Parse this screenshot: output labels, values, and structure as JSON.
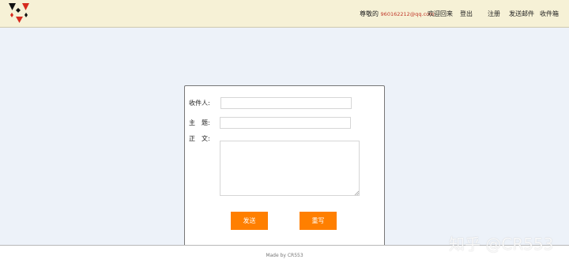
{
  "header": {
    "greeting_prefix": "尊敬的",
    "user_email": "960162212@qq.com",
    "welcome": "欢迎回来",
    "nav": {
      "logout": "登出",
      "register": "注册",
      "send_mail": "发送邮件",
      "inbox": "收件箱"
    }
  },
  "form": {
    "recipient_label": "收件人:",
    "recipient_value": "",
    "subject_label": "主　题:",
    "subject_value": "",
    "body_label": "正　文:",
    "body_value": "",
    "send_button": "发送",
    "rewrite_button": "重写"
  },
  "footer": {
    "text": "Made by CR553"
  },
  "watermark": "知乎 @CR553",
  "colors": {
    "header_bg": "#f6f1d6",
    "page_bg": "#edf2f9",
    "accent": "#ff7f00",
    "email": "#c0392b"
  }
}
